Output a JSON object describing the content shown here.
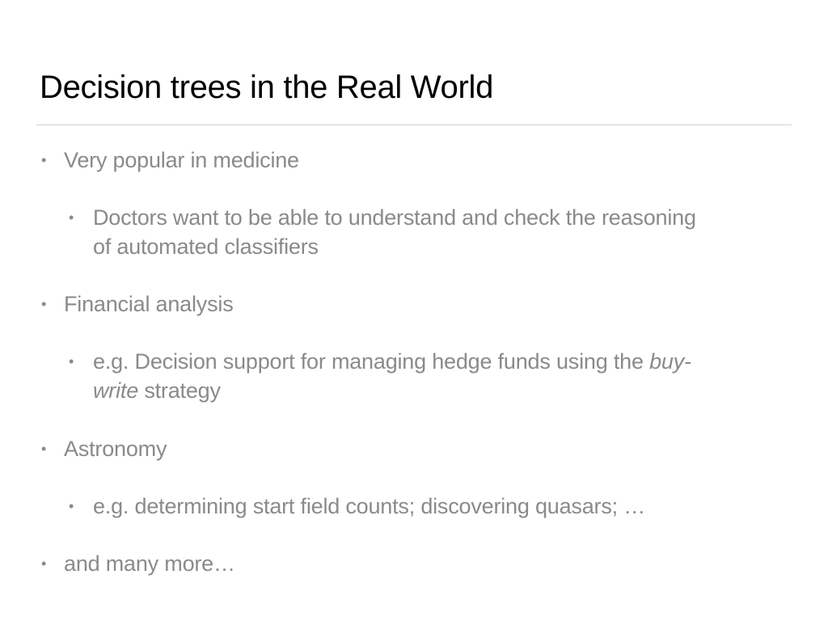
{
  "slide": {
    "title": "Decision trees in the Real World",
    "bullet_char": "•",
    "items": [
      {
        "level": 1,
        "text": "Very popular in medicine"
      },
      {
        "level": 2,
        "line1": "Doctors want to be able to understand and check the reasoning",
        "line2": "of automated classifiers"
      },
      {
        "level": 1,
        "text": "Financial analysis"
      },
      {
        "level": 2,
        "line1_pre": "e.g. Decision support for managing hedge funds using the ",
        "line1_italic": "buy-",
        "line2_italic": "write",
        "line2_post": " strategy"
      },
      {
        "level": 1,
        "text": "Astronomy"
      },
      {
        "level": 2,
        "text": "e.g. determining start field counts; discovering quasars; …"
      },
      {
        "level": 1,
        "text": "and many more…"
      }
    ]
  },
  "colors": {
    "title": "#000000",
    "body_text": "#8a8a8a",
    "divider": "#cfcfcf",
    "background": "#ffffff"
  }
}
